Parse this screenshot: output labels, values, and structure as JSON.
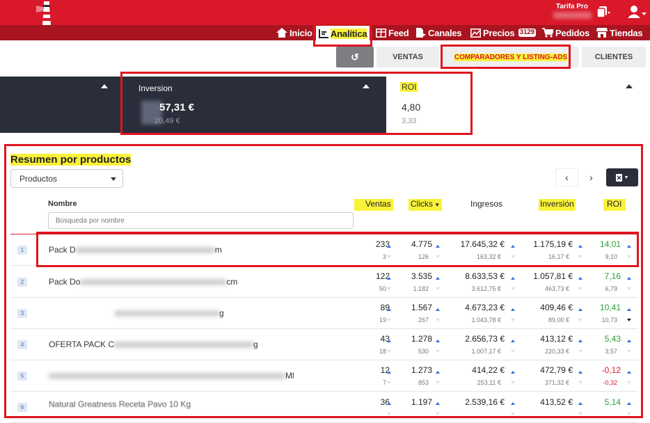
{
  "topbar": {
    "plan_label": "Tarifa Pro",
    "nav": [
      {
        "label": "Inicio",
        "icon": "home-icon"
      },
      {
        "label": "Analítica",
        "icon": "analytics-icon"
      },
      {
        "label": "Feed",
        "icon": "grid-icon"
      },
      {
        "label": "Canales",
        "icon": "document-icon"
      },
      {
        "label": "Precios",
        "icon": "chart-icon",
        "badge": "3129"
      },
      {
        "label": "Pedidos",
        "icon": "cart-icon"
      },
      {
        "label": "Tiendas",
        "icon": "store-icon"
      }
    ]
  },
  "tabs": {
    "reset_icon": "↺",
    "items": [
      "VENTAS",
      "COMPARADORES Y LISTING-ADS",
      "CLIENTES"
    ]
  },
  "metrics": {
    "inversion": {
      "title": "Inversion",
      "value": "57,31 €",
      "sub": "20,49 €"
    },
    "roi": {
      "title": "ROI",
      "value": "4,80",
      "sub": "3,33"
    }
  },
  "summary": {
    "title": "Resumen por productos",
    "select_value": "Productos",
    "columns": {
      "name": "Nombre",
      "ventas": "Ventas",
      "clicks": "Clicks",
      "ingresos": "Ingresos",
      "inversion": "Inversión",
      "roi": "ROI"
    },
    "search_placeholder": "Búsqueda por nombre",
    "rows": [
      {
        "idx": "1",
        "name": "Pack D",
        "name_end": "m",
        "ventas": "233",
        "ventas_sub": "3",
        "clicks": "4.775",
        "clicks_sub": "126",
        "ingresos": "17.645,32 €",
        "ingresos_sub": "163,32 €",
        "inversion": "1.175,19 €",
        "inversion_sub": "16,17 €",
        "roi": "14,01",
        "roi_sub": "9,10",
        "roi_sign": "pos"
      },
      {
        "idx": "2",
        "name": "Pack Do",
        "name_end": "cm",
        "ventas": "122",
        "ventas_sub": "50",
        "clicks": "3.535",
        "clicks_sub": "1.182",
        "ingresos": "8.633,53 €",
        "ingresos_sub": "3.612,75 €",
        "inversion": "1.057,81 €",
        "inversion_sub": "463,73 €",
        "roi": "7,16",
        "roi_sub": "6,79",
        "roi_sign": "pos"
      },
      {
        "idx": "3",
        "name": "",
        "name_end": "g",
        "ventas": "89",
        "ventas_sub": "19",
        "clicks": "1.567",
        "clicks_sub": "267",
        "ingresos": "4.673,23 €",
        "ingresos_sub": "1.043,78 €",
        "inversion": "409,46 €",
        "inversion_sub": "89,00 €",
        "roi": "10,41",
        "roi_sub": "10,73",
        "roi_sign": "pos"
      },
      {
        "idx": "4",
        "name": "OFERTA PACK C",
        "name_end": "g",
        "ventas": "43",
        "ventas_sub": "18",
        "clicks": "1.278",
        "clicks_sub": "530",
        "ingresos": "2.656,73 €",
        "ingresos_sub": "1.007,17 €",
        "inversion": "413,12 €",
        "inversion_sub": "220,33 €",
        "roi": "5,43",
        "roi_sub": "3,57",
        "roi_sign": "pos"
      },
      {
        "idx": "5",
        "name": "",
        "name_end": "Ml",
        "ventas": "12",
        "ventas_sub": "7",
        "clicks": "1.273",
        "clicks_sub": "853",
        "ingresos": "414,22 €",
        "ingresos_sub": "253,11 €",
        "inversion": "472,79 €",
        "inversion_sub": "371,32 €",
        "roi": "-0,12",
        "roi_sub": "-0,32",
        "roi_sign": "neg"
      },
      {
        "idx": "6",
        "name": "Natural Greatness Receta Pavo 10 Kg",
        "name_end": "",
        "ventas": "36",
        "ventas_sub": "",
        "clicks": "1.197",
        "clicks_sub": "",
        "ingresos": "2.539,16 €",
        "ingresos_sub": "",
        "inversion": "413,52 €",
        "inversion_sub": "",
        "roi": "5,14",
        "roi_sub": "",
        "roi_sign": "pos"
      }
    ]
  },
  "colors": {
    "brand_red": "#d9182a",
    "dark_nav": "#a8141f",
    "panel_dark": "#2a2d3a",
    "highlight": "#f9f23a",
    "positive": "#2a9d3b"
  }
}
